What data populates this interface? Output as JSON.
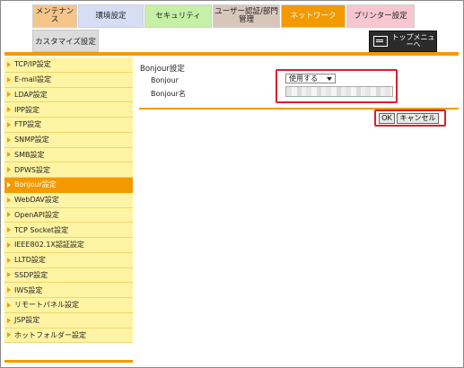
{
  "tabs": [
    {
      "label": "メンテナンス",
      "bg": "#f5c58a",
      "active": false
    },
    {
      "label": "環境設定",
      "bg": "#d6def5",
      "active": false
    },
    {
      "label": "セキュリティ",
      "bg": "#c5f0a5",
      "active": false
    },
    {
      "label": "ユーザー認証/部門管理",
      "bg": "#d8c6bb",
      "active": false
    },
    {
      "label": "ネットワーク",
      "bg": "#f39a00",
      "active": true
    },
    {
      "label": "プリンター設定",
      "bg": "#f7c6cf",
      "active": false
    }
  ],
  "subtab": {
    "label": "カスタマイズ設定"
  },
  "top_menu": {
    "label": "トップメニューへ",
    "icon": "screen-icon"
  },
  "sidebar": {
    "items": [
      {
        "label": "TCP/IP設定",
        "active": false
      },
      {
        "label": "E-mail設定",
        "active": false
      },
      {
        "label": "LDAP設定",
        "active": false
      },
      {
        "label": "IPP設定",
        "active": false
      },
      {
        "label": "FTP設定",
        "active": false
      },
      {
        "label": "SNMP設定",
        "active": false
      },
      {
        "label": "SMB設定",
        "active": false
      },
      {
        "label": "DPWS設定",
        "active": false
      },
      {
        "label": "Bonjour設定",
        "active": true
      },
      {
        "label": "WebDAV設定",
        "active": false
      },
      {
        "label": "OpenAPI設定",
        "active": false
      },
      {
        "label": "TCP Socket設定",
        "active": false
      },
      {
        "label": "IEEE802.1X認証設定",
        "active": false
      },
      {
        "label": "LLTD設定",
        "active": false
      },
      {
        "label": "SSDP設定",
        "active": false
      },
      {
        "label": "IWS設定",
        "active": false
      },
      {
        "label": "リモートパネル設定",
        "active": false
      },
      {
        "label": "JSP設定",
        "active": false
      },
      {
        "label": "ホットフォルダー設定",
        "active": false
      }
    ]
  },
  "main": {
    "title": "Bonjour設定",
    "bonjour_label": "Bonjour",
    "bonjour_value": "使用する",
    "name_label": "Bonjour名",
    "name_value": ""
  },
  "buttons": {
    "ok": "OK",
    "cancel": "キャンセル"
  },
  "colors": {
    "accent": "#f39a00",
    "highlight": "#d9212a",
    "sidebar_bg": "#fff4a3"
  }
}
